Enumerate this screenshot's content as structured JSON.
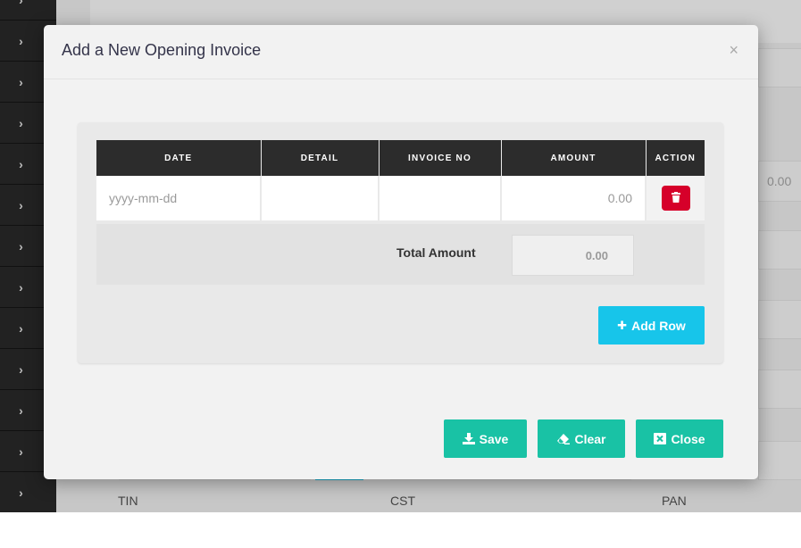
{
  "modal": {
    "title": "Add a New Opening Invoice",
    "close_glyph": "×"
  },
  "table": {
    "headers": [
      "DATE",
      "DETAIL",
      "INVOICE NO",
      "AMOUNT",
      "ACTION"
    ],
    "row": {
      "date_placeholder": "yyyy-mm-dd",
      "detail_value": "",
      "invoice_no_value": "",
      "amount_placeholder": "0.00"
    }
  },
  "total": {
    "label": "Total Amount",
    "value": "0.00"
  },
  "buttons": {
    "add_row": "Add Row",
    "save": "Save",
    "clear": "Clear",
    "close": "Close"
  },
  "background": {
    "labels": [
      "TIN",
      "CST",
      "PAN"
    ],
    "amount_value": "0.00"
  },
  "colors": {
    "header_bg": "#2c2c2c",
    "delete": "#d6002a",
    "add_row": "#17c5ea",
    "action_teal": "#19c2a5"
  },
  "icons": {
    "sidebar": "chevron-right-icon",
    "delete": "trash-icon",
    "add_row": "plus-icon",
    "save": "download-icon",
    "clear": "eraser-icon",
    "close": "close-square-icon"
  }
}
